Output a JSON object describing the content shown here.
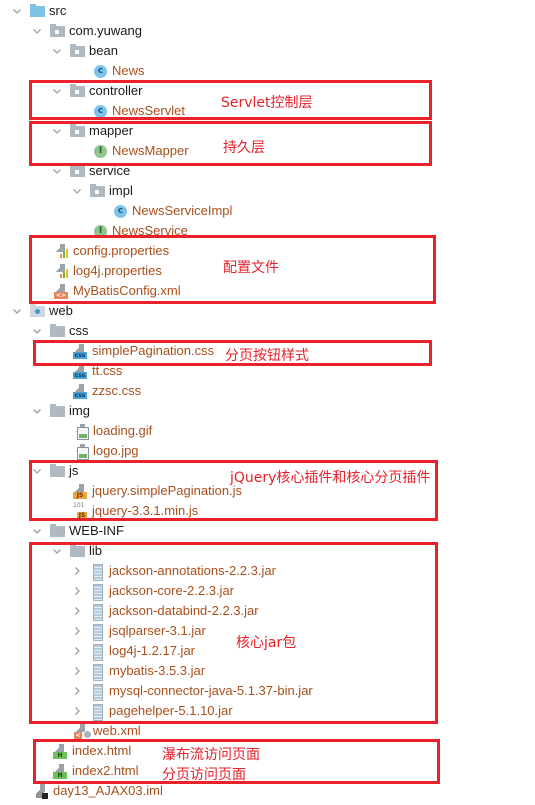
{
  "tree": [
    {
      "label": "src",
      "depth": 0,
      "expanded": true,
      "icon": "source-folder-icon",
      "kind": "folder-src"
    },
    {
      "label": "com.yuwang",
      "depth": 1,
      "expanded": true,
      "icon": "package-icon",
      "kind": "package"
    },
    {
      "label": "bean",
      "depth": 2,
      "expanded": true,
      "icon": "package-icon",
      "kind": "package"
    },
    {
      "label": "News",
      "depth": 3,
      "icon": "class-icon",
      "kind": "class",
      "glyph": "c"
    },
    {
      "label": "controller",
      "depth": 2,
      "expanded": true,
      "icon": "package-icon",
      "kind": "package"
    },
    {
      "label": "NewsServlet",
      "depth": 3,
      "icon": "class-icon",
      "kind": "class",
      "glyph": "c"
    },
    {
      "label": "mapper",
      "depth": 2,
      "expanded": true,
      "icon": "package-icon",
      "kind": "package"
    },
    {
      "label": "NewsMapper",
      "depth": 3,
      "icon": "interface-icon",
      "kind": "interface",
      "glyph": "I"
    },
    {
      "label": "service",
      "depth": 2,
      "expanded": true,
      "icon": "package-icon",
      "kind": "package"
    },
    {
      "label": "impl",
      "depth": 3,
      "expanded": true,
      "icon": "package-icon",
      "kind": "package"
    },
    {
      "label": "NewsServiceImpl",
      "depth": 4,
      "icon": "class-icon",
      "kind": "class",
      "glyph": "c"
    },
    {
      "label": "NewsService",
      "depth": 3,
      "icon": "interface-icon",
      "kind": "interface",
      "glyph": "I"
    },
    {
      "label": "config.properties",
      "depth": 1,
      "icon": "properties-file-icon",
      "kind": "properties"
    },
    {
      "label": "log4j.properties",
      "depth": 1,
      "icon": "properties-file-icon",
      "kind": "properties"
    },
    {
      "label": "MyBatisConfig.xml",
      "depth": 1,
      "icon": "xml-file-icon",
      "kind": "xml",
      "badge": "<>"
    },
    {
      "label": "web",
      "depth": 0,
      "expanded": true,
      "icon": "web-folder-icon",
      "kind": "folder-web"
    },
    {
      "label": "css",
      "depth": 1,
      "expanded": true,
      "icon": "folder-icon",
      "kind": "folder"
    },
    {
      "label": "simplePagination.css",
      "depth": 2,
      "icon": "css-file-icon",
      "kind": "css",
      "badge": "css"
    },
    {
      "label": "tt.css",
      "depth": 2,
      "icon": "css-file-icon",
      "kind": "css",
      "badge": "css"
    },
    {
      "label": "zzsc.css",
      "depth": 2,
      "icon": "css-file-icon",
      "kind": "css",
      "badge": "css"
    },
    {
      "label": "img",
      "depth": 1,
      "expanded": true,
      "icon": "folder-icon",
      "kind": "folder"
    },
    {
      "label": "loading.gif",
      "depth": 2,
      "icon": "image-file-icon",
      "kind": "image"
    },
    {
      "label": "logo.jpg",
      "depth": 2,
      "icon": "image-file-icon",
      "kind": "image"
    },
    {
      "label": "js",
      "depth": 1,
      "expanded": true,
      "icon": "folder-icon",
      "kind": "folder"
    },
    {
      "label": "jquery.simplePagination.js",
      "depth": 2,
      "icon": "js-file-icon",
      "kind": "js",
      "badge": "JS"
    },
    {
      "label": "jquery-3.3.1.min.js",
      "depth": 2,
      "icon": "minified-js-file-icon",
      "kind": "minjs",
      "badge": "JS",
      "bin": "101"
    },
    {
      "label": "WEB-INF",
      "depth": 1,
      "expanded": true,
      "icon": "folder-icon",
      "kind": "folder"
    },
    {
      "label": "lib",
      "depth": 2,
      "expanded": true,
      "icon": "folder-icon",
      "kind": "folder"
    },
    {
      "label": "jackson-annotations-2.2.3.jar",
      "depth": 3,
      "expanded": false,
      "icon": "jar-icon",
      "kind": "jar"
    },
    {
      "label": "jackson-core-2.2.3.jar",
      "depth": 3,
      "expanded": false,
      "icon": "jar-icon",
      "kind": "jar"
    },
    {
      "label": "jackson-databind-2.2.3.jar",
      "depth": 3,
      "expanded": false,
      "icon": "jar-icon",
      "kind": "jar"
    },
    {
      "label": "jsqlparser-3.1.jar",
      "depth": 3,
      "expanded": false,
      "icon": "jar-icon",
      "kind": "jar"
    },
    {
      "label": "log4j-1.2.17.jar",
      "depth": 3,
      "expanded": false,
      "icon": "jar-icon",
      "kind": "jar"
    },
    {
      "label": "mybatis-3.5.3.jar",
      "depth": 3,
      "expanded": false,
      "icon": "jar-icon",
      "kind": "jar"
    },
    {
      "label": "mysql-connector-java-5.1.37-bin.jar",
      "depth": 3,
      "expanded": false,
      "icon": "jar-icon",
      "kind": "jar"
    },
    {
      "label": "pagehelper-5.1.10.jar",
      "depth": 3,
      "expanded": false,
      "icon": "jar-icon",
      "kind": "jar"
    },
    {
      "label": "web.xml",
      "depth": 2,
      "icon": "web-xml-file-icon",
      "kind": "webxml"
    },
    {
      "label": "index.html",
      "depth": 1,
      "icon": "html-file-icon",
      "kind": "html",
      "badge": "H"
    },
    {
      "label": "index2.html",
      "depth": 1,
      "icon": "html-file-icon",
      "kind": "html",
      "badge": "H"
    },
    {
      "label": "day13_AJAX03.iml",
      "depth": 0,
      "icon": "module-file-icon",
      "kind": "iml"
    }
  ],
  "annotations": [
    {
      "id": "controller",
      "text": "Servlet控制层"
    },
    {
      "id": "mapper",
      "text": "持久层"
    },
    {
      "id": "config",
      "text": "配置文件"
    },
    {
      "id": "css",
      "text": "分页按钮样式"
    },
    {
      "id": "js",
      "text": "jQuery核心插件和核心分页插件"
    },
    {
      "id": "lib",
      "text": "核心jar包"
    },
    {
      "id": "index",
      "text": "瀑布流访问页面"
    },
    {
      "id": "index2",
      "text": "分页访问页面"
    }
  ],
  "colors": {
    "annotation_red": "#e8212a",
    "file_text_orange": "#a8501c",
    "folder_text": "#1a1a1a"
  }
}
